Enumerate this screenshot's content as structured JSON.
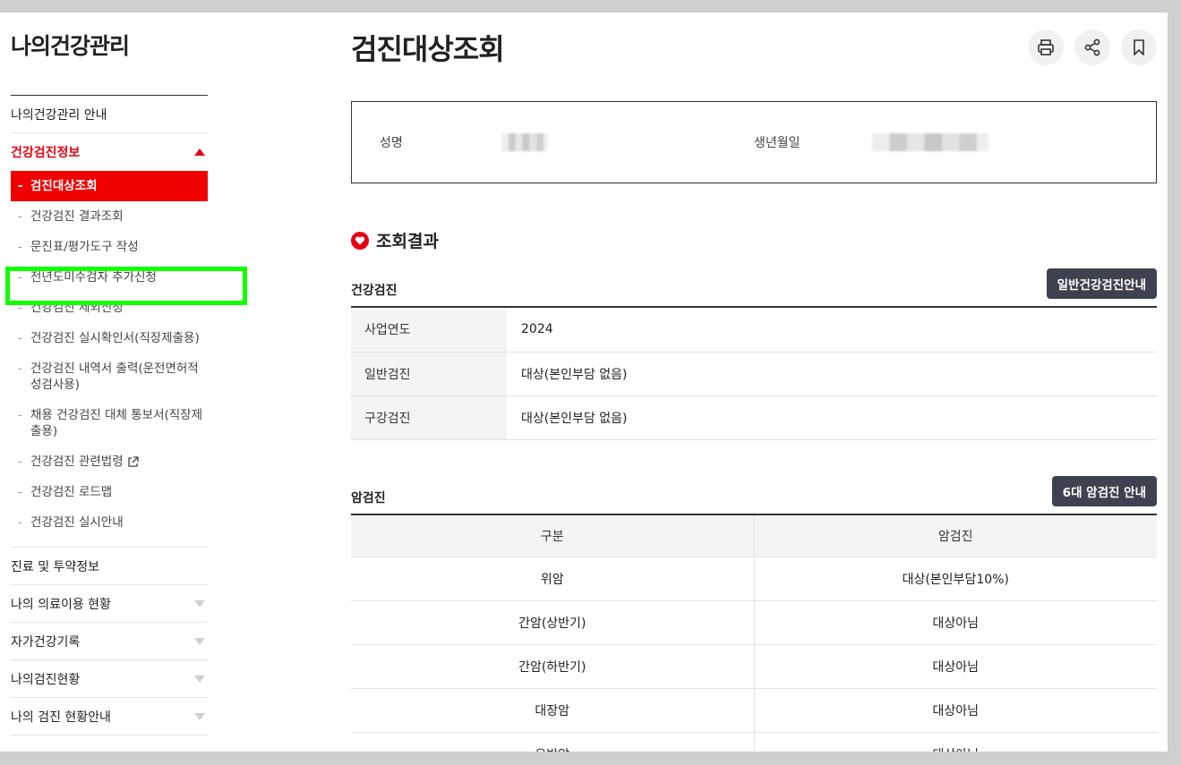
{
  "sidebar": {
    "title": "나의건강관리",
    "menu": [
      {
        "label": "나의건강관리 안내"
      },
      {
        "label": "건강검진정보"
      },
      {
        "label": "진료 및 투약정보"
      },
      {
        "label": "나의 의료이용 현황"
      },
      {
        "label": "자가건강기록"
      },
      {
        "label": "나의검진현황"
      },
      {
        "label": "나의 검진 현황안내"
      }
    ],
    "sub_items": [
      {
        "label": "검진대상조회"
      },
      {
        "label": "건강검진 결과조회"
      },
      {
        "label": "문진표/평가도구 작성"
      },
      {
        "label": "전년도미수검자 추가신청"
      },
      {
        "label": "건강검진 제외신청"
      },
      {
        "label": "건강검진 실시확인서(직장제출용)"
      },
      {
        "label": "건강검진 내역서 출력(운전면허적성검사용)"
      },
      {
        "label": "채용 건강검진 대체 통보서(직장제출용)"
      },
      {
        "label": "건강검진 관련법령"
      },
      {
        "label": "건강검진 로드맵"
      },
      {
        "label": "건강검진 실시안내"
      }
    ]
  },
  "main": {
    "title": "검진대상조회",
    "tools": [
      "print-icon",
      "share-icon",
      "bookmark-icon"
    ],
    "info": {
      "name_label": "성명",
      "birth_label": "생년월일"
    },
    "result_title": "조회결과",
    "health": {
      "title": "건강검진",
      "button": "일반건강검진안내",
      "rows": [
        {
          "label": "사업연도",
          "value": "2024"
        },
        {
          "label": "일반검진",
          "value": "대상(본인부담 없음)"
        },
        {
          "label": "구강검진",
          "value": "대상(본인부담 없음)"
        }
      ]
    },
    "cancer": {
      "title": "암검진",
      "button": "6대 암검진 안내",
      "headers": [
        "구분",
        "암검진"
      ],
      "rows": [
        {
          "type": "위암",
          "status": "대상(본인부담10%)"
        },
        {
          "type": "간암(상반기)",
          "status": "대상아님"
        },
        {
          "type": "간암(하반기)",
          "status": "대상아님"
        },
        {
          "type": "대장암",
          "status": "대상아님"
        },
        {
          "type": "유방암",
          "status": "대상아님"
        }
      ]
    }
  },
  "colors": {
    "accent": "#e60012",
    "highlight": "#11ff00",
    "button_dark": "#3d4150"
  }
}
